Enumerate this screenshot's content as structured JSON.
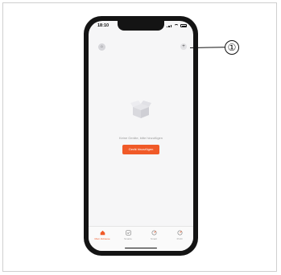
{
  "statusbar": {
    "time": "18:10"
  },
  "header": {
    "home_icon": "house-icon",
    "add_icon": "plus-icon"
  },
  "empty_state": {
    "message": "Keine Geräte, bitte hinzufügen",
    "add_device_label": "Gerät hinzufügen",
    "accent_color": "#f05a28"
  },
  "tabs": [
    {
      "label": "Mein Zuhause",
      "icon": "home-icon",
      "active": true
    },
    {
      "label": "Smarte",
      "icon": "checkbox-icon",
      "active": false
    },
    {
      "label": "Smart",
      "icon": "target-icon",
      "active": false
    },
    {
      "label": "Profil",
      "icon": "user-icon",
      "active": false
    }
  ],
  "callout": {
    "label": "①"
  }
}
